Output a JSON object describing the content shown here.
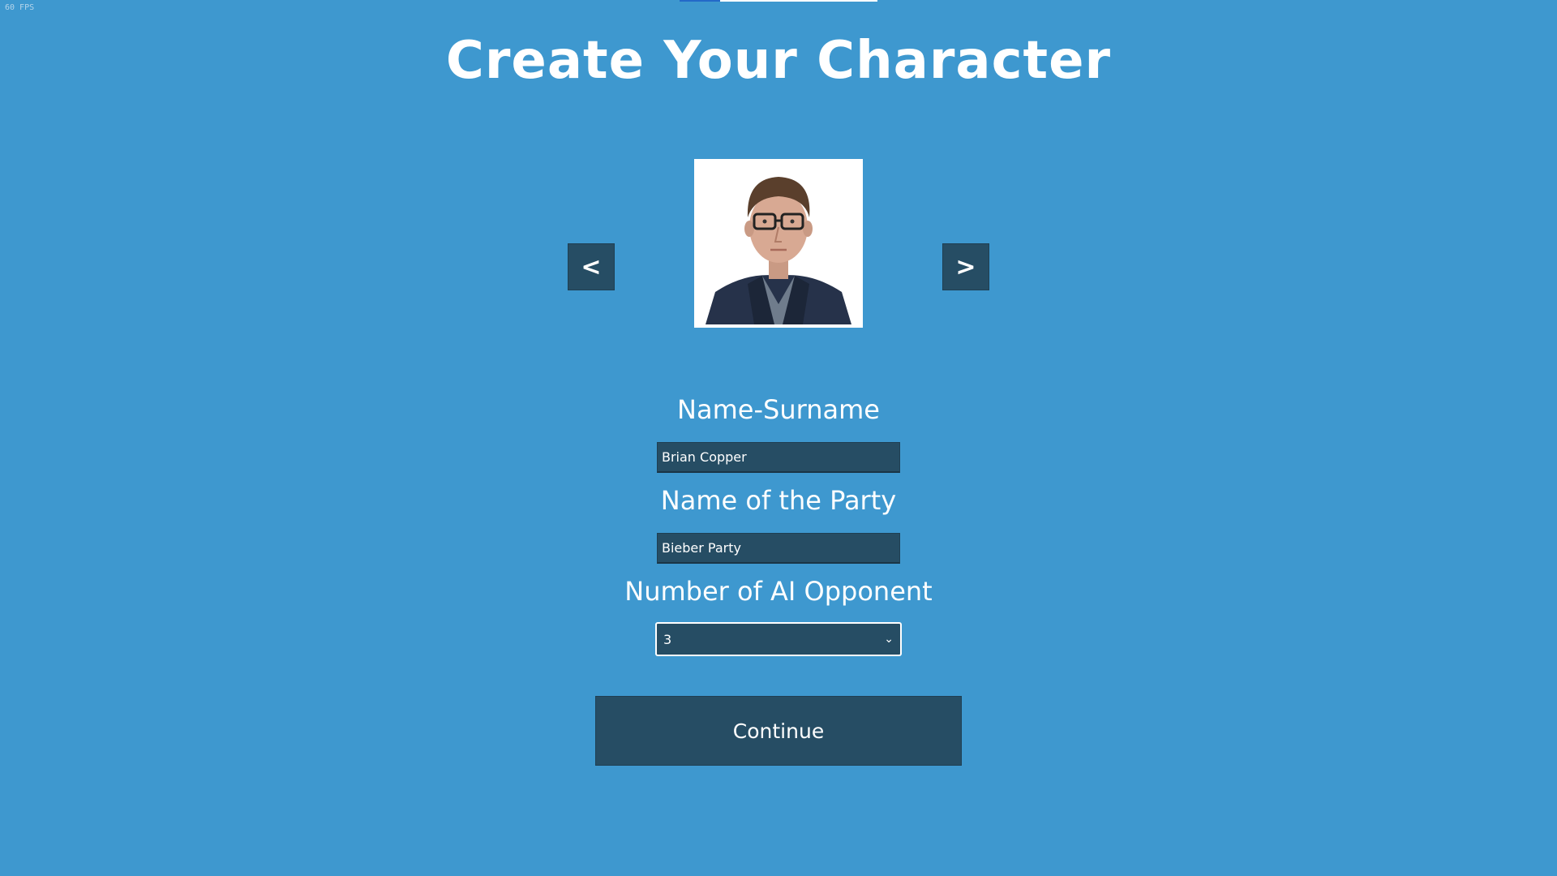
{
  "debug": {
    "fps_text": "60 FPS"
  },
  "title": "Create Your Character",
  "portrait": {
    "prev_label": "<",
    "next_label": ">",
    "image_alt": "character-portrait"
  },
  "form": {
    "name_label": "Name-Surname",
    "name_value": "Brian Copper",
    "party_label": "Name of the Party",
    "party_value": "Bieber Party",
    "ai_label": "Number of AI Opponent",
    "ai_selected": "3"
  },
  "continue_label": "Continue",
  "colors": {
    "background": "#3e98cf",
    "panel": "#264d64",
    "text": "#ffffff"
  }
}
